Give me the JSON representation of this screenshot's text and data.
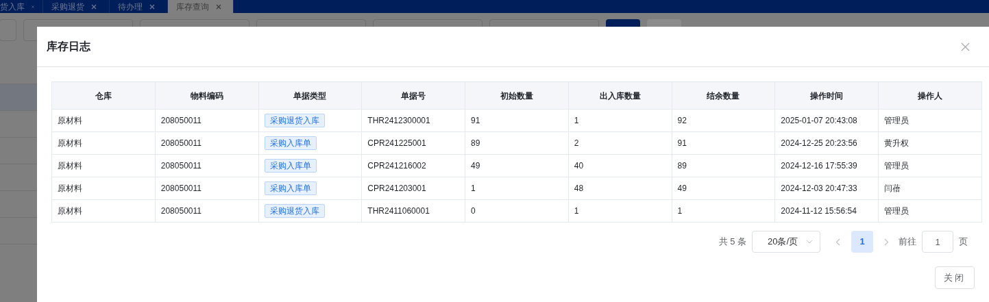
{
  "tabs": [
    {
      "label": "货入库",
      "selected": false
    },
    {
      "label": "采购退货",
      "selected": false
    },
    {
      "label": "待办理",
      "selected": false
    },
    {
      "label": "库存查询",
      "selected": true
    }
  ],
  "dialog": {
    "title": "库存日志",
    "table": {
      "columns": [
        "仓库",
        "物料编码",
        "单据类型",
        "单据号",
        "初始数量",
        "出入库数量",
        "结余数量",
        "操作时间",
        "操作人"
      ],
      "rows": [
        [
          "原材料",
          "208050011",
          "采购退货入库",
          "THR2412300001",
          "91",
          "1",
          "92",
          "2025-01-07 20:43:08",
          "管理员"
        ],
        [
          "原材料",
          "208050011",
          "采购入库单",
          "CPR241225001",
          "89",
          "2",
          "91",
          "2024-12-25 20:23:56",
          "黄升权"
        ],
        [
          "原材料",
          "208050011",
          "采购入库单",
          "CPR241216002",
          "49",
          "40",
          "89",
          "2024-12-16 17:55:39",
          "管理员"
        ],
        [
          "原材料",
          "208050011",
          "采购入库单",
          "CPR241203001",
          "1",
          "48",
          "49",
          "2024-12-03 20:47:33",
          "闫蓓"
        ],
        [
          "原材料",
          "208050011",
          "采购退货入库",
          "THR2411060001",
          "0",
          "1",
          "1",
          "2024-11-12 15:56:54",
          "管理员"
        ]
      ]
    },
    "pagination": {
      "total": "共 5 条",
      "page_size": "20条/页",
      "pages": [
        {
          "label": "1",
          "selected": true
        }
      ],
      "goto_label": "前往",
      "goto_value": "1",
      "page_suffix": "页"
    },
    "close_button": "关闭"
  }
}
